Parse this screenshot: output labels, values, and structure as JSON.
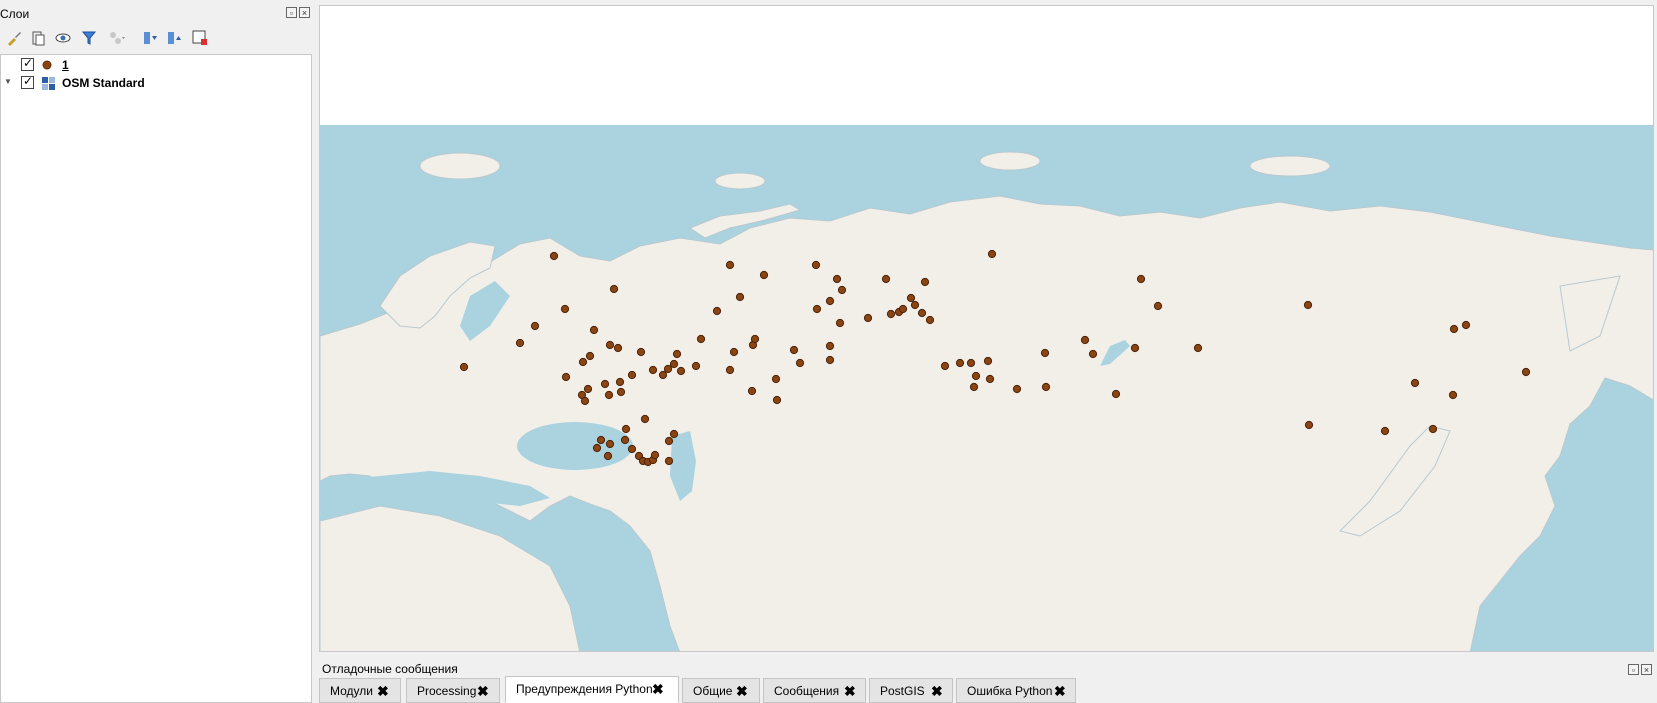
{
  "layers_panel": {
    "title": "Слои",
    "layers": [
      {
        "label": "1",
        "checked": true,
        "icon": "point-symbol-icon"
      },
      {
        "label": "OSM Standard",
        "checked": true,
        "icon": "raster-tile-icon",
        "expand": "▼"
      }
    ]
  },
  "map": {
    "ocean_color": "#aad3df",
    "land_color": "#f2efe9",
    "point_color": "#8b4513"
  },
  "log_panel": {
    "title": "Отладочные сообщения",
    "tabs": [
      {
        "label": "Модули"
      },
      {
        "label": "Processing"
      },
      {
        "label": "Предупреждения Python",
        "active": true
      },
      {
        "label": "Общие"
      },
      {
        "label": "Сообщения"
      },
      {
        "label": "PostGIS"
      },
      {
        "label": "Ошибка Python"
      }
    ],
    "close_glyph": "✖"
  }
}
